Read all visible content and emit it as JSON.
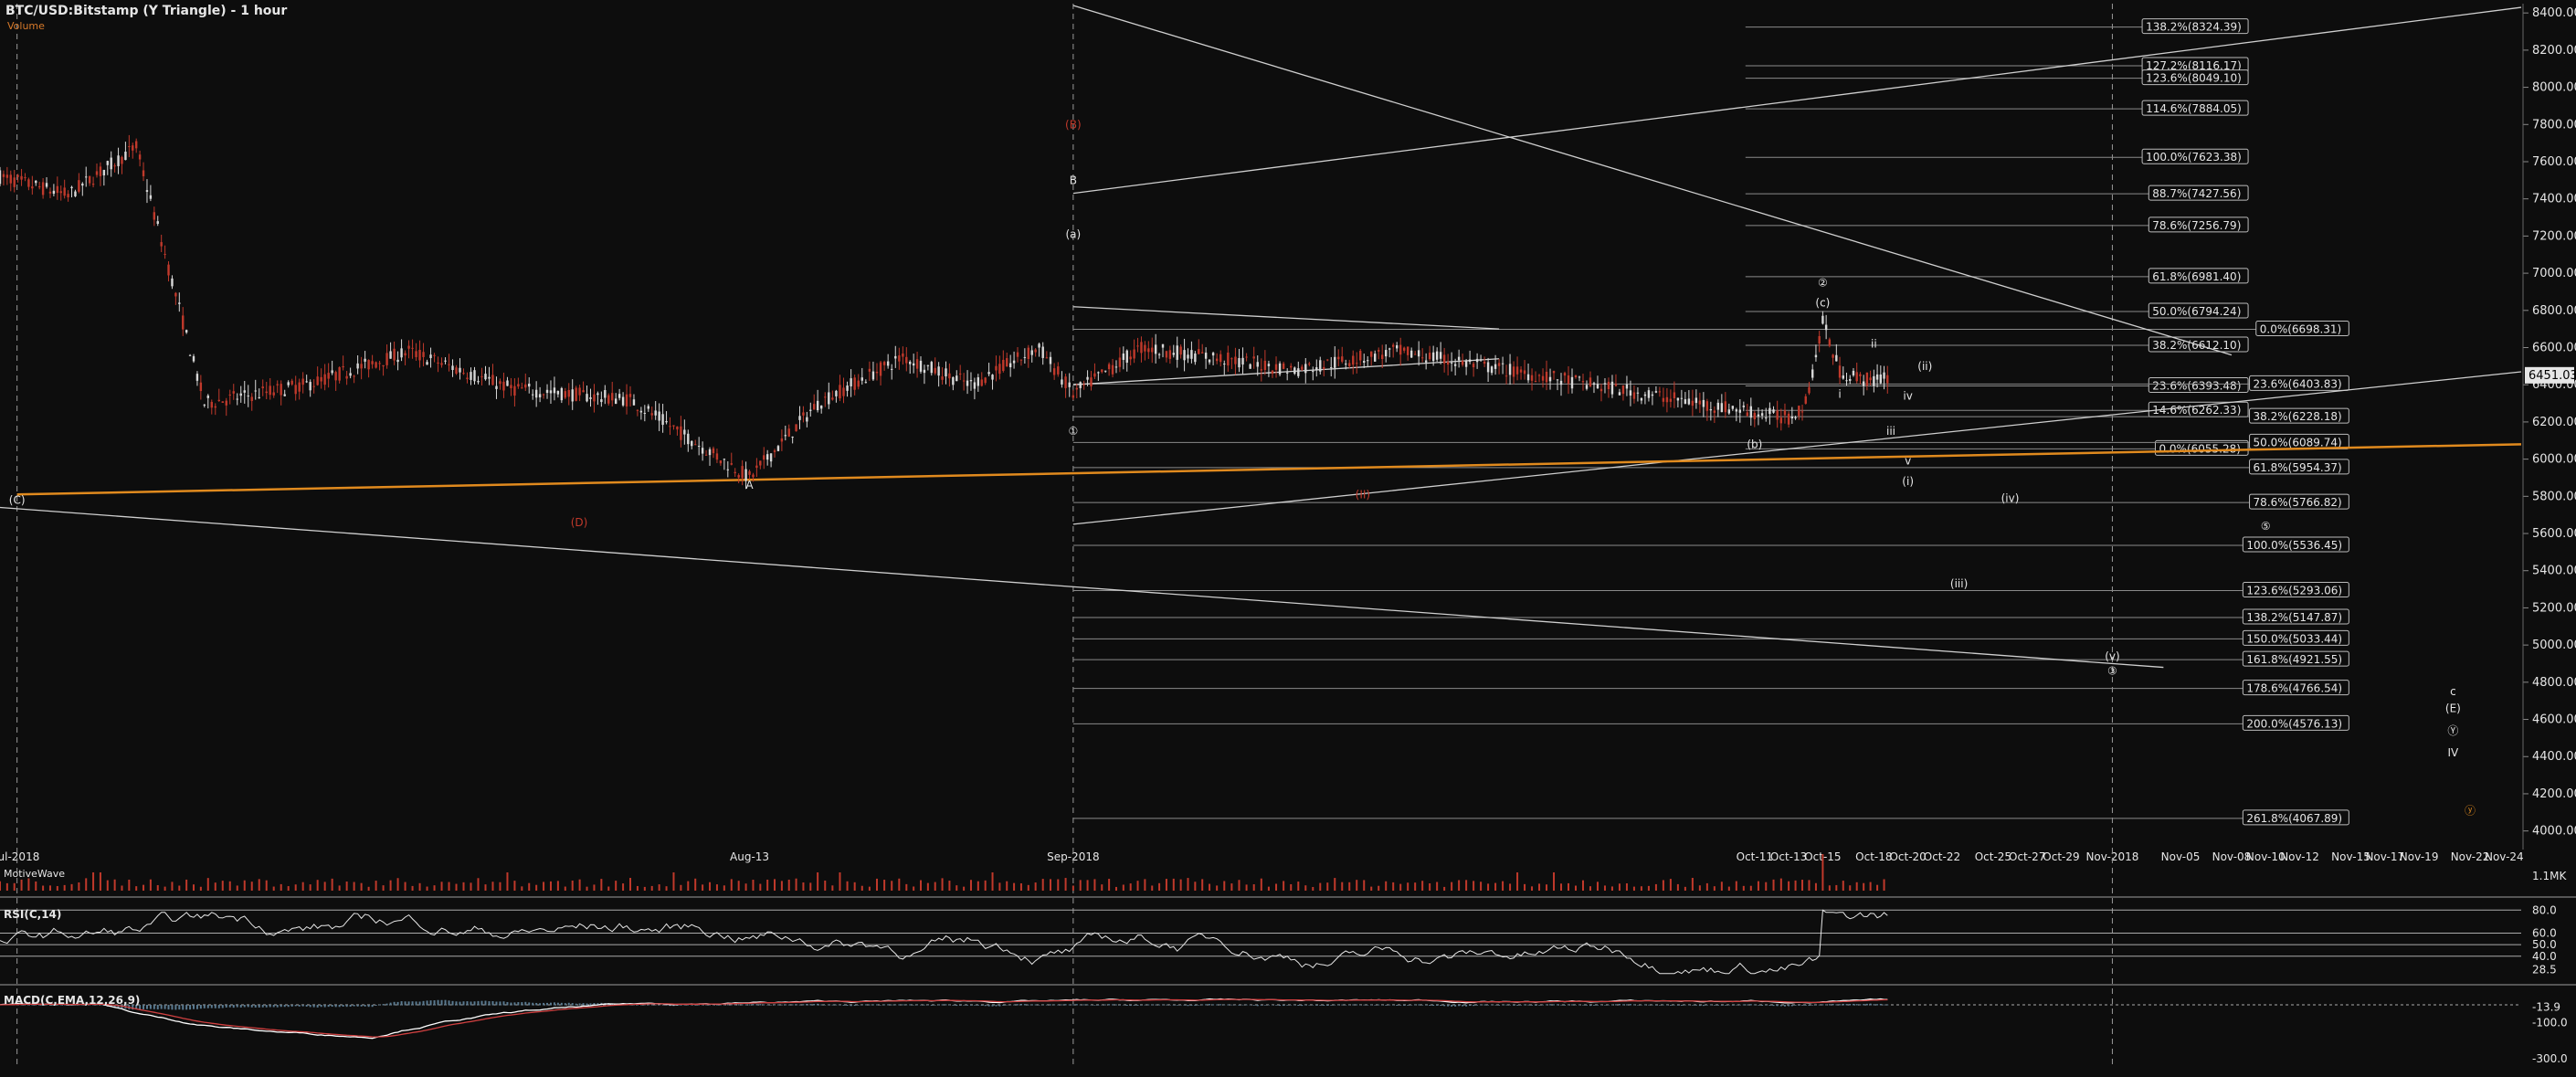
{
  "header": {
    "title": "BTC/USD:Bitstamp (Y Triangle) - 1 hour",
    "volume_label": "Volume"
  },
  "panels": {
    "volume_label": "MotiveWave",
    "rsi_label": "RSI(C,14)",
    "macd_label": "MACD(C,EMA,12,26,9)"
  },
  "colors": {
    "background": "#0d0d0d",
    "grid": "#3a3a3a",
    "text": "#e6e6e6",
    "candle_up": "#d8d8d8",
    "candle_down": "#c0392b",
    "orange_line": "#e08a1e",
    "red_label": "#c0392b",
    "macd_line": "#ffffff",
    "signal_line": "#d04040",
    "histogram": "#5a7a90",
    "volume_bars": "#c0392b"
  },
  "chart_data": {
    "type": "candlestick",
    "symbol": "BTC/USD",
    "exchange": "Bitstamp",
    "timeframe": "1 hour",
    "y_range": [
      3900,
      8450
    ],
    "y_ticks": [
      4000,
      4200,
      4400,
      4600,
      4800,
      5000,
      5200,
      5400,
      5600,
      5800,
      6000,
      6200,
      6400,
      6600,
      6800,
      7000,
      7200,
      7400,
      7600,
      7800,
      8000,
      8200,
      8400
    ],
    "y_tick_labels": [
      "4000.00",
      "4200.00",
      "4400.00",
      "4600.00",
      "4800.00",
      "5000.00",
      "5200.00",
      "5400.00",
      "5600.00",
      "5800.00",
      "6000.00",
      "6200.00",
      "6400.00",
      "6600.00",
      "6800.00",
      "7000.00",
      "7200.00",
      "7400.00",
      "7600.00",
      "7800.00",
      "8000.00",
      "8200.00",
      "8400.00"
    ],
    "last_price": 6451.03,
    "last_price_label": "6451.03",
    "x_range": [
      "2018-06-30",
      "2018-11-25"
    ],
    "x_ticks": [
      {
        "date": "2018-07-01",
        "label": "Jul-2018"
      },
      {
        "date": "2018-08-13",
        "label": "Aug-13"
      },
      {
        "date": "2018-09-01",
        "label": "Sep-2018"
      },
      {
        "date": "2018-10-11",
        "label": "Oct-11"
      },
      {
        "date": "2018-10-13",
        "label": "Oct-13"
      },
      {
        "date": "2018-10-15",
        "label": "Oct-15"
      },
      {
        "date": "2018-10-18",
        "label": "Oct-18"
      },
      {
        "date": "2018-10-20",
        "label": "Oct-20"
      },
      {
        "date": "2018-10-22",
        "label": "Oct-22"
      },
      {
        "date": "2018-10-25",
        "label": "Oct-25"
      },
      {
        "date": "2018-10-27",
        "label": "Oct-27"
      },
      {
        "date": "2018-10-29",
        "label": "Oct-29"
      },
      {
        "date": "2018-11-01",
        "label": "Nov-2018"
      },
      {
        "date": "2018-11-05",
        "label": "Nov-05"
      },
      {
        "date": "2018-11-08",
        "label": "Nov-08"
      },
      {
        "date": "2018-11-10",
        "label": "Nov-10"
      },
      {
        "date": "2018-11-12",
        "label": "Nov-12"
      },
      {
        "date": "2018-11-15",
        "label": "Nov-15"
      },
      {
        "date": "2018-11-17",
        "label": "Nov-17"
      },
      {
        "date": "2018-11-19",
        "label": "Nov-19"
      },
      {
        "date": "2018-11-22",
        "label": "Nov-22"
      },
      {
        "date": "2018-11-24",
        "label": "Nov-24"
      }
    ],
    "price_path": [
      {
        "x": "2018-06-30",
        "y": 7520
      },
      {
        "x": "2018-07-04",
        "y": 7420
      },
      {
        "x": "2018-07-08",
        "y": 7680
      },
      {
        "x": "2018-07-12",
        "y": 6300
      },
      {
        "x": "2018-07-18",
        "y": 6400
      },
      {
        "x": "2018-07-24",
        "y": 6580
      },
      {
        "x": "2018-07-30",
        "y": 6380
      },
      {
        "x": "2018-08-06",
        "y": 6320
      },
      {
        "x": "2018-08-13",
        "y": 5900
      },
      {
        "x": "2018-08-17",
        "y": 6300
      },
      {
        "x": "2018-08-22",
        "y": 6550
      },
      {
        "x": "2018-08-26",
        "y": 6400
      },
      {
        "x": "2018-08-30",
        "y": 6600
      },
      {
        "x": "2018-09-01",
        "y": 6350
      },
      {
        "x": "2018-09-05",
        "y": 6600
      },
      {
        "x": "2018-09-09",
        "y": 6550
      },
      {
        "x": "2018-09-14",
        "y": 6480
      },
      {
        "x": "2018-09-20",
        "y": 6580
      },
      {
        "x": "2018-10-11",
        "y": 6250
      },
      {
        "x": "2018-10-13",
        "y": 6220
      },
      {
        "x": "2018-10-14",
        "y": 6300
      },
      {
        "x": "2018-10-15",
        "y": 6740
      },
      {
        "x": "2018-10-16",
        "y": 6470
      },
      {
        "x": "2018-10-17",
        "y": 6440
      },
      {
        "x": "2018-10-18",
        "y": 6420
      },
      {
        "x": "2018-10-19",
        "y": 6451
      }
    ],
    "fib_levels_left": [
      {
        "pct": "138.2%",
        "price": 8324.39,
        "label": "138.2%(8324.39)"
      },
      {
        "pct": "127.2%",
        "price": 8116.17,
        "label": "127.2%(8116.17)"
      },
      {
        "pct": "123.6%",
        "price": 8049.1,
        "label": "123.6%(8049.10)"
      },
      {
        "pct": "114.6%",
        "price": 7884.05,
        "label": "114.6%(7884.05)"
      },
      {
        "pct": "100.0%",
        "price": 7623.38,
        "label": "100.0%(7623.38)"
      },
      {
        "pct": "88.7%",
        "price": 7427.56,
        "label": "88.7%(7427.56)"
      },
      {
        "pct": "78.6%",
        "price": 7256.79,
        "label": "78.6%(7256.79)"
      },
      {
        "pct": "61.8%",
        "price": 6981.4,
        "label": "61.8%(6981.40)"
      },
      {
        "pct": "50.0%",
        "price": 6794.24,
        "label": "50.0%(6794.24)"
      },
      {
        "pct": "38.2%",
        "price": 6612.1,
        "label": "38.2%(6612.10)"
      },
      {
        "pct": "23.6%",
        "price": 6393.48,
        "label": "23.6%(6393.48)"
      },
      {
        "pct": "14.6%",
        "price": 6262.33,
        "label": "14.6%(6262.33)"
      },
      {
        "pct": "0.0%",
        "price": 6055.28,
        "label": "0.0%(6055.28)"
      }
    ],
    "fib_levels_right": [
      {
        "pct": "0.0%",
        "price": 6698.31,
        "label": "0.0%(6698.31)"
      },
      {
        "pct": "23.6%",
        "price": 6403.83,
        "label": "23.6%(6403.83)"
      },
      {
        "pct": "38.2%",
        "price": 6228.18,
        "label": "38.2%(6228.18)"
      },
      {
        "pct": "50.0%",
        "price": 6089.74,
        "label": "50.0%(6089.74)"
      },
      {
        "pct": "61.8%",
        "price": 5954.37,
        "label": "61.8%(5954.37)"
      },
      {
        "pct": "78.6%",
        "price": 5766.82,
        "label": "78.6%(5766.82)"
      },
      {
        "pct": "100.0%",
        "price": 5536.45,
        "label": "100.0%(5536.45)"
      },
      {
        "pct": "123.6%",
        "price": 5293.06,
        "label": "123.6%(5293.06)"
      },
      {
        "pct": "138.2%",
        "price": 5147.87,
        "label": "138.2%(5147.87)"
      },
      {
        "pct": "150.0%",
        "price": 5033.44,
        "label": "150.0%(5033.44)"
      },
      {
        "pct": "161.8%",
        "price": 4921.55,
        "label": "161.8%(4921.55)"
      },
      {
        "pct": "178.6%",
        "price": 4766.54,
        "label": "178.6%(4766.54)"
      },
      {
        "pct": "200.0%",
        "price": 4576.13,
        "label": "200.0%(4576.13)"
      },
      {
        "pct": "261.8%",
        "price": 4067.89,
        "label": "261.8%(4067.89)"
      }
    ],
    "trendlines": [
      {
        "name": "upper-wedge-line",
        "from": {
          "x": "2018-09-01",
          "y": 8440
        },
        "to": {
          "x": "2018-11-08",
          "y": 6560
        },
        "color": "#cfcfcf"
      },
      {
        "name": "rising-upper-line",
        "from": {
          "x": "2018-09-01",
          "y": 7430
        },
        "to": {
          "x": "2018-11-25",
          "y": 8430
        },
        "color": "#cfcfcf"
      },
      {
        "name": "rising-lower-line",
        "from": {
          "x": "2018-09-01",
          "y": 5650
        },
        "to": {
          "x": "2018-11-25",
          "y": 6470
        },
        "color": "#cfcfcf"
      },
      {
        "name": "orange-support-line",
        "from": {
          "x": "2018-07-01",
          "y": 5810
        },
        "to": {
          "x": "2018-11-25",
          "y": 6080
        },
        "color": "#e08a1e"
      },
      {
        "name": "descending-lower-line",
        "from": {
          "x": "2018-06-30",
          "y": 5740
        },
        "to": {
          "x": "2018-11-04",
          "y": 4880
        },
        "color": "#cfcfcf"
      },
      {
        "name": "short-segment-a",
        "from": {
          "x": "2018-09-01",
          "y": 6820
        },
        "to": {
          "x": "2018-09-26",
          "y": 6700
        },
        "color": "#cfcfcf"
      },
      {
        "name": "short-segment-b",
        "from": {
          "x": "2018-09-01",
          "y": 6400
        },
        "to": {
          "x": "2018-09-26",
          "y": 6540
        },
        "color": "#cfcfcf"
      }
    ],
    "wave_labels": [
      {
        "text": "(C)",
        "x": "2018-07-01",
        "y": 5760,
        "color": "#e6e6e6"
      },
      {
        "text": "(D)",
        "x": "2018-08-03",
        "y": 5640,
        "color": "#c0392b"
      },
      {
        "text": "A",
        "x": "2018-08-13",
        "y": 5840,
        "color": "#e6e6e6"
      },
      {
        "text": "B",
        "x": "2018-09-01",
        "y": 7480,
        "color": "#e6e6e6"
      },
      {
        "text": "(B)",
        "x": "2018-09-01",
        "y": 7780,
        "color": "#c0392b"
      },
      {
        "text": "(a)",
        "x": "2018-09-01",
        "y": 7190,
        "color": "#e6e6e6"
      },
      {
        "text": "①",
        "x": "2018-09-01",
        "y": 6130,
        "color": "#e6e6e6"
      },
      {
        "text": "(II)",
        "x": "2018-09-18",
        "y": 5790,
        "color": "#c0392b"
      },
      {
        "text": "(b)",
        "x": "2018-10-11",
        "y": 6060,
        "color": "#e6e6e6"
      },
      {
        "text": "②",
        "x": "2018-10-15",
        "y": 6930,
        "color": "#e6e6e6"
      },
      {
        "text": "(c)",
        "x": "2018-10-15",
        "y": 6820,
        "color": "#e6e6e6"
      },
      {
        "text": "ii",
        "x": "2018-10-18",
        "y": 6600,
        "color": "#e6e6e6"
      },
      {
        "text": "i",
        "x": "2018-10-16",
        "y": 6330,
        "color": "#e6e6e6"
      },
      {
        "text": "(ii)",
        "x": "2018-10-21",
        "y": 6480,
        "color": "#e6e6e6"
      },
      {
        "text": "iv",
        "x": "2018-10-20",
        "y": 6320,
        "color": "#e6e6e6"
      },
      {
        "text": "iii",
        "x": "2018-10-19",
        "y": 6130,
        "color": "#e6e6e6"
      },
      {
        "text": "v",
        "x": "2018-10-20",
        "y": 5970,
        "color": "#e6e6e6"
      },
      {
        "text": "(i)",
        "x": "2018-10-20",
        "y": 5860,
        "color": "#e6e6e6"
      },
      {
        "text": "(iv)",
        "x": "2018-10-26",
        "y": 5770,
        "color": "#e6e6e6"
      },
      {
        "text": "(iii)",
        "x": "2018-10-23",
        "y": 5310,
        "color": "#e6e6e6"
      },
      {
        "text": "(v)",
        "x": "2018-11-01",
        "y": 4920,
        "color": "#e6e6e6"
      },
      {
        "text": "③",
        "x": "2018-11-01",
        "y": 4840,
        "color": "#e6e6e6"
      },
      {
        "text": "⑤",
        "x": "2018-11-10",
        "y": 5620,
        "color": "#e6e6e6"
      },
      {
        "text": "c",
        "x": "2018-11-21",
        "y": 4730,
        "color": "#e6e6e6"
      },
      {
        "text": "(E)",
        "x": "2018-11-21",
        "y": 4640,
        "color": "#e6e6e6"
      },
      {
        "text": "Ⓨ",
        "x": "2018-11-21",
        "y": 4520,
        "color": "#e6e6e6"
      },
      {
        "text": "IV",
        "x": "2018-11-21",
        "y": 4400,
        "color": "#e6e6e6"
      },
      {
        "text": "ⓨ",
        "x": "2018-11-22",
        "y": 4090,
        "color": "#e08a1e"
      }
    ],
    "vertical_markers": [
      "2018-07-01",
      "2018-09-01",
      "2018-11-01"
    ],
    "volume_panel": {
      "y_tick_label": "1.1MK"
    },
    "rsi_panel": {
      "period": 14,
      "y_tick_labels": [
        "80.0",
        "60.0",
        "50.0",
        "40.0",
        "28.5"
      ],
      "levels": [
        80,
        60,
        50,
        40
      ],
      "last": 28.5
    },
    "macd_panel": {
      "fast": 12,
      "slow": 26,
      "signal": 9,
      "y_tick_labels": [
        "-13.9",
        "-100.0",
        "-300.0"
      ],
      "last": -13.9
    }
  }
}
